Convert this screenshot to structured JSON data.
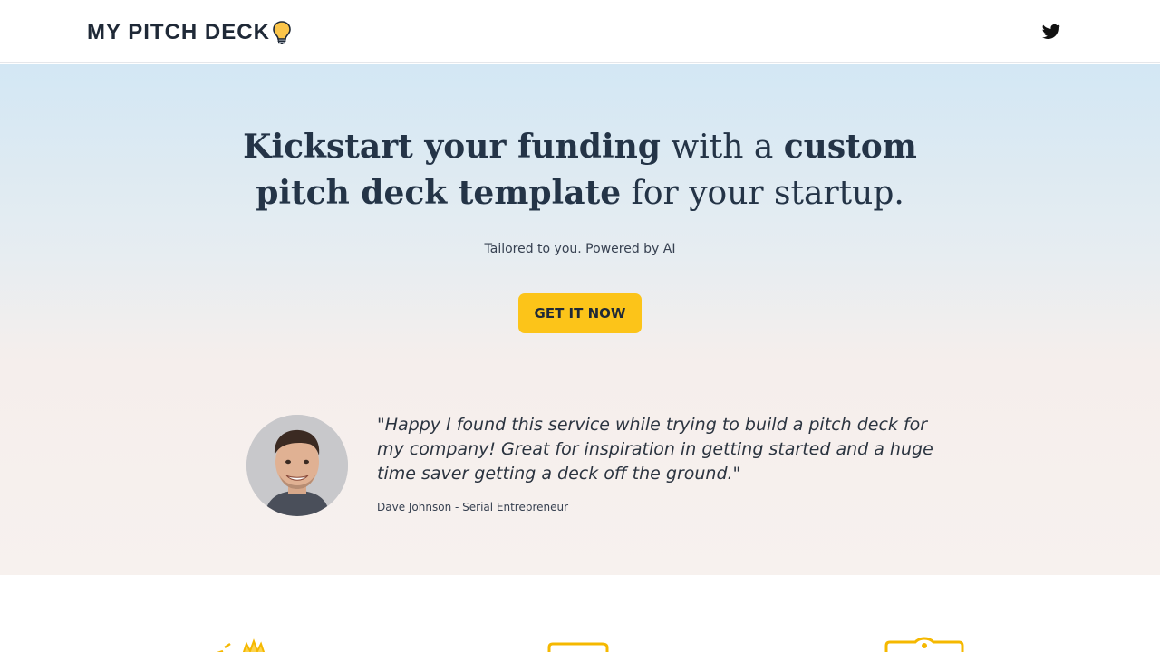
{
  "header": {
    "brand": "MY PITCH DECK",
    "brand_icon": "lightbulb-icon",
    "social_icon": "twitter-icon"
  },
  "hero": {
    "headline": {
      "part1_bold": "Kickstart your funding",
      "part2": " with a ",
      "part3_bold": "custom pitch deck template",
      "part4": " for your startup."
    },
    "subtitle": "Tailored to you. Powered by AI",
    "cta_label": "GET IT NOW"
  },
  "testimonial": {
    "quote": "\"Happy I found this service while trying to build a pitch deck for my company! Great for inspiration in getting started and a huge time saver getting a deck off the ground.\"",
    "author": "Dave Johnson - Serial Entrepreneur",
    "avatar": "avatar"
  },
  "features": {
    "icons": [
      "sparkle-icon",
      "document-icon",
      "tag-icon"
    ]
  },
  "colors": {
    "accent": "#fcc419",
    "text_dark": "#243447",
    "hero_top": "#d3e7f4",
    "hero_bottom": "#f7f1ee"
  }
}
